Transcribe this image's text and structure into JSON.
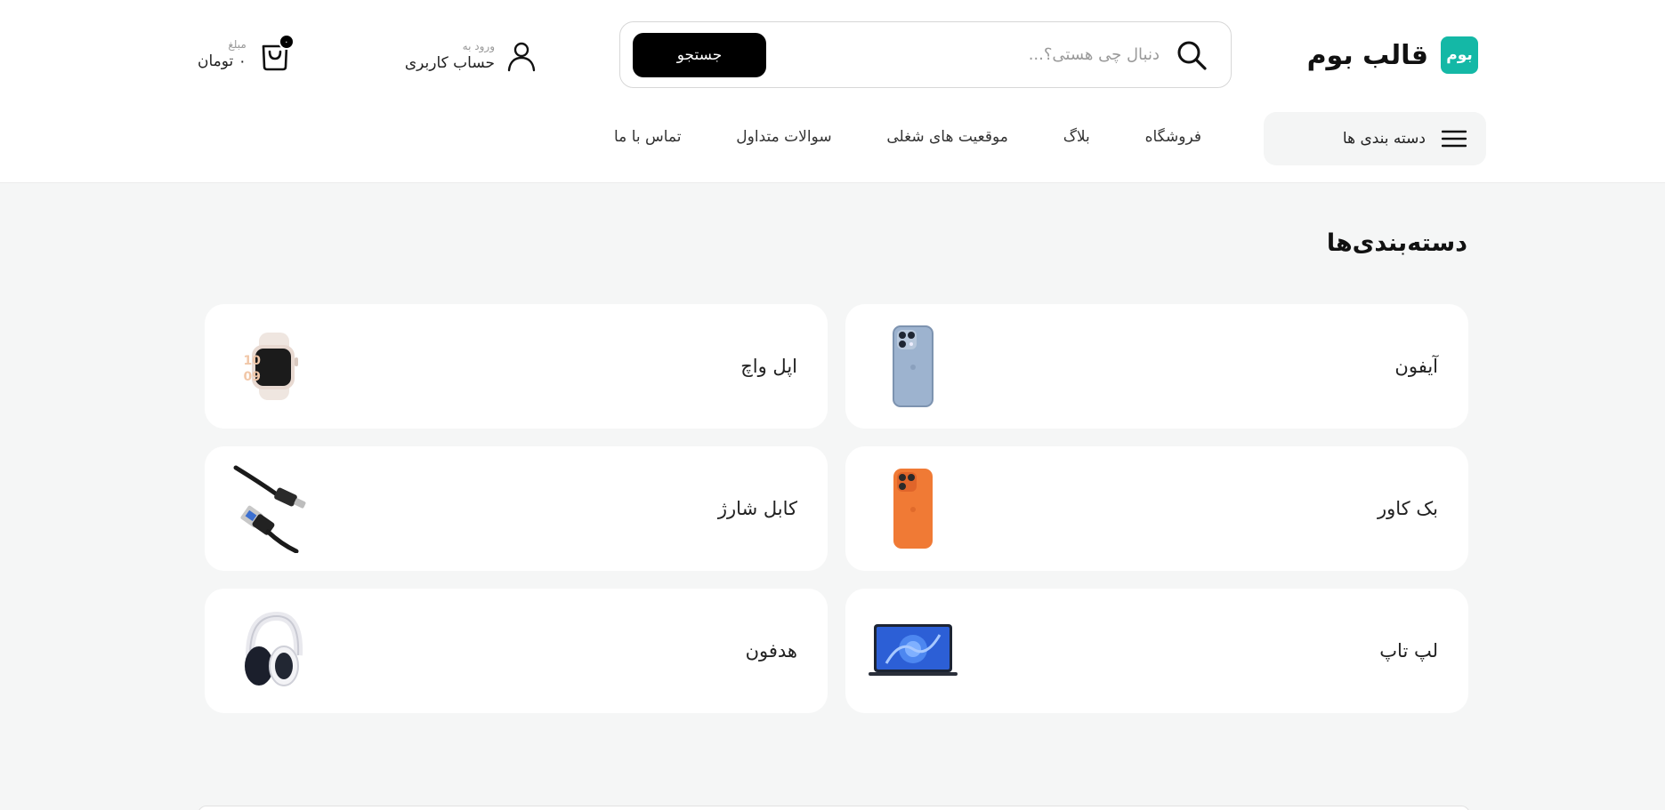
{
  "header": {
    "logo_badge": "بوم",
    "logo_text": "قالب بوم",
    "search": {
      "placeholder": "دنبال چی هستی؟...",
      "button_label": "جستجو"
    },
    "account": {
      "small_label": "ورود به",
      "main_label": "حساب کاربری"
    },
    "cart": {
      "count": "۰",
      "small_label": "مبلغ",
      "amount": "۰ تومان"
    },
    "categories_button": "دسته بندی ها",
    "nav": [
      {
        "label": "فروشگاه"
      },
      {
        "label": "بلاگ"
      },
      {
        "label": "موقعیت های شغلی"
      },
      {
        "label": "سوالات متداول"
      },
      {
        "label": "تماس با ما"
      }
    ]
  },
  "main": {
    "section_title": "دسته‌بندی‌ها",
    "categories": [
      {
        "label": "آیفون",
        "icon": "iphone-image"
      },
      {
        "label": "اپل واچ",
        "icon": "apple-watch-image"
      },
      {
        "label": "بک کاور",
        "icon": "back-cover-image"
      },
      {
        "label": "کابل شارژ",
        "icon": "charging-cable-image"
      },
      {
        "label": "لپ تاپ",
        "icon": "laptop-image"
      },
      {
        "label": "هدفون",
        "icon": "headphone-image"
      }
    ]
  },
  "colors": {
    "brand": "#14b8a6",
    "button_bg": "#000000",
    "page_bg": "#f5f6f6"
  }
}
